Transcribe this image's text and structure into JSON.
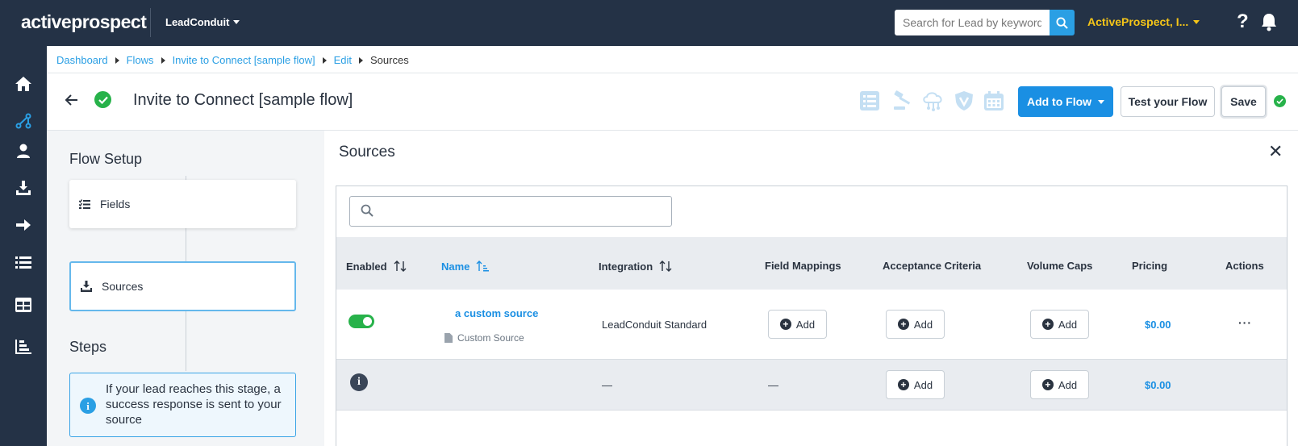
{
  "app": {
    "logo_text": "activeprospect",
    "product": "LeadConduit",
    "search_placeholder": "Search for Lead by keyword",
    "account": "ActiveProspect, I...",
    "help": "?"
  },
  "nav": {
    "items": [
      "home-icon",
      "flows-icon",
      "user-icon",
      "download-icon",
      "arrow-right-icon",
      "list-icon",
      "table-icon",
      "chart-icon"
    ]
  },
  "breadcrumb": [
    {
      "label": "Dashboard",
      "link": true
    },
    {
      "label": "Flows",
      "link": true
    },
    {
      "label": "Invite to Connect [sample flow]",
      "link": true
    },
    {
      "label": "Edit",
      "link": true
    },
    {
      "label": "Sources",
      "link": false
    }
  ],
  "header": {
    "title": "Invite to Connect [sample flow]",
    "add_to_flow": "Add to Flow",
    "test_flow": "Test your Flow",
    "save": "Save"
  },
  "flow_setup": {
    "heading": "Flow Setup",
    "fields_label": "Fields",
    "sources_label": "Sources",
    "steps_heading": "Steps",
    "info_text": "If your lead reaches this stage, a success response is sent to your source"
  },
  "sources": {
    "title": "Sources",
    "columns": {
      "enabled": "Enabled",
      "name": "Name",
      "integration": "Integration",
      "field_mappings": "Field Mappings",
      "acceptance_criteria": "Acceptance Criteria",
      "volume_caps": "Volume Caps",
      "pricing": "Pricing",
      "actions": "Actions"
    },
    "rows": [
      {
        "enabled": true,
        "name": "a custom source",
        "type": "Custom Source",
        "integration": "LeadConduit Standard",
        "field_mappings": "Add",
        "acceptance_criteria": "Add",
        "volume_caps": "Add",
        "pricing": "$0.00",
        "actions": "···"
      },
      {
        "integration": "—",
        "field_mappings": "—",
        "acceptance_criteria": "Add",
        "volume_caps": "Add",
        "pricing": "$0.00"
      }
    ]
  },
  "colors": {
    "topbar": "#243246",
    "accent": "#1a8fe3",
    "success": "#27b24a",
    "account": "#f5c518"
  }
}
